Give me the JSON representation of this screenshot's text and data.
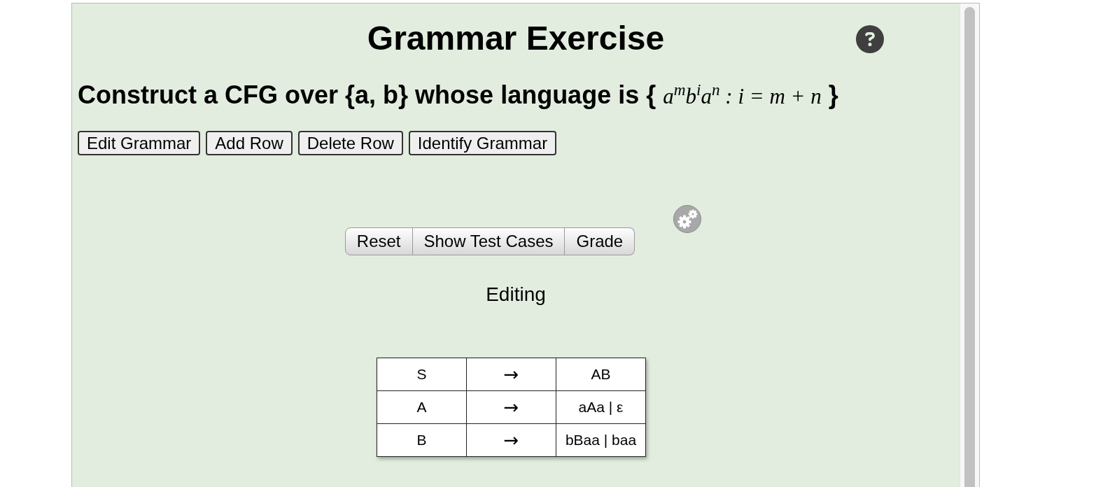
{
  "title": "Grammar Exercise",
  "prompt": {
    "text": "Construct a CFG over {a, b} whose language is {",
    "math": "a$^{m}$b$^{i}$a$^{n}$ : i = m + n",
    "closing": "}"
  },
  "toolbar": [
    "Edit Grammar",
    "Add Row",
    "Delete Row",
    "Identify Grammar"
  ],
  "actions": [
    "Reset",
    "Show Test Cases",
    "Grade"
  ],
  "status": "Editing",
  "grammar": {
    "rows": [
      {
        "variable": "S",
        "arrow": "→",
        "production": "AB"
      },
      {
        "variable": "A",
        "arrow": "→",
        "production": "aAa | ε"
      },
      {
        "variable": "B",
        "arrow": "→",
        "production": "bBaa | baa"
      }
    ]
  }
}
